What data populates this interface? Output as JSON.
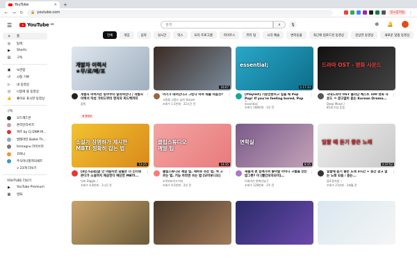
{
  "browser": {
    "tab_title": "YouTube",
    "url": "youtube.com",
    "profile_status": "일시중지됨"
  },
  "masthead": {
    "logo_text": "YouTube",
    "logo_region": "KR",
    "search_placeholder": "검색"
  },
  "sidebar": {
    "main": [
      {
        "icon": "home-icon",
        "glyph": "⌂",
        "label": "홈",
        "active": true
      },
      {
        "icon": "explore-icon",
        "glyph": "◎",
        "label": "탐색"
      },
      {
        "icon": "shorts-icon",
        "glyph": "▶",
        "label": "Shorts"
      },
      {
        "icon": "subscriptions-icon",
        "glyph": "▤",
        "label": "구독"
      }
    ],
    "library": [
      {
        "icon": "library-icon",
        "glyph": "▣",
        "label": "보관함"
      },
      {
        "icon": "history-icon",
        "glyph": "↺",
        "label": "시청 기록"
      },
      {
        "icon": "my-videos-icon",
        "glyph": "▷",
        "label": "내 동영상"
      },
      {
        "icon": "watch-later-icon",
        "glyph": "◷",
        "label": "나중에 볼 동영상"
      },
      {
        "icon": "liked-icon",
        "glyph": "👍",
        "label": "좋아요 표시한 동영상"
      }
    ],
    "subs_heading": "구독",
    "subscriptions": [
      {
        "label": "모드헤드폰",
        "color": "#333"
      },
      {
        "label": "온라인리서치",
        "color": "#c9a"
      },
      {
        "label": "퀴즈 by CJ ENM M...",
        "color": "#d33"
      },
      {
        "label": "발레마티 Ballet Th...",
        "color": "#8ab"
      },
      {
        "label": "Ilcmagnu 라이브러",
        "color": "#777"
      },
      {
        "label": "코파니",
        "color": "#e93"
      },
      {
        "label": "주식이나할까의세트",
        "color": "#39c"
      },
      {
        "label": "∨ 23개 더보기",
        "color": ""
      }
    ],
    "more_heading": "YOUTUBE 더보기",
    "more": [
      {
        "icon": "premium-icon",
        "glyph": "▶",
        "label": "YouTube Premium"
      },
      {
        "icon": "movies-icon",
        "glyph": "▦",
        "label": "영화"
      }
    ]
  },
  "chips": [
    "전체",
    "게임",
    "음악",
    "실시간",
    "믹스",
    "요리 프로그램",
    "라이트스",
    "뷰티 팁",
    "시각 예술",
    "변리동물",
    "최근에 업로드된 동영상",
    "감상한 동영상",
    "새로운 맞춤 동영상"
  ],
  "videos": [
    {
      "title": "개발자 이력서는 링쿠부터 달라야한다 | 개발자 이력서 작성 가이드부터 현직자 피드백까지",
      "channel": "잡톡",
      "stats": "",
      "badge": "새 동영상",
      "duration": "",
      "thumb_bg": "linear-gradient(135deg,#dfe6ee,#9fb0c0)",
      "thumb_text": "개발자 이력서\n★무/료/배/포",
      "text_color": "#111",
      "avatar": "#222"
    },
    {
      "title": "아기가 태어난다고 그린나 이여 뭐를 마음것?",
      "channel": "고원용 고종드 남자 Yonam",
      "stats": "조회수 1.5만회 · 22시간 전",
      "badge": "",
      "duration": "16:07",
      "thumb_bg": "linear-gradient(135deg,#3b2b24,#7a8b9b)",
      "thumb_text": "",
      "text_color": "#fff",
      "avatar": "#964"
    },
    {
      "title": "[Playlist] 기분전환하고 싶을 때 Pop Pop! If you're feeling bored, Pop Pop!",
      "channel": "essential;",
      "stats": "조회수 188만회 · 1년 전",
      "badge": "",
      "duration": "1:17:33",
      "thumb_bg": "linear-gradient(135deg,#2aa7c9,#0c6e8a)",
      "thumb_text": "essential;",
      "text_color": "#fff",
      "avatar": "#1a9"
    },
    {
      "title": "국내드라마 OST 플리단 베스트 100 명화 사운드 ㅋ 광고없이 듣는 Korean Drama...",
      "channel": "Deep Mood ♪",
      "stats": "85세 이상 듣음",
      "badge": "",
      "duration": "",
      "thumb_bg": "linear-gradient(135deg,#111,#444)",
      "thumb_text": "드라마 OST - 명화 사운드",
      "text_color": "#e44",
      "avatar": "#555"
    },
    {
      "title": "[4인가공원]글 안 마음이면 남들은 더 인터넷 본다가 소설까지 제공한다 예단한 MBTI...",
      "channel": "다표 Diggle ✓",
      "stats": "조회수 4.8만회 · 1시간 전",
      "badge": "",
      "duration": "13:25",
      "thumb_bg": "linear-gradient(135deg,#f2c230,#d98a1a)",
      "thumb_text": "소설가 장명하가 제시한\nMBTI 정확히 잡는 법",
      "text_color": "#fff",
      "avatar": "#e33"
    },
    {
      "title": "클립스튜디오 깨알 팁, 세브로 쓰는 법, 색 고르는 법, 기능 아라면 쓰는 법 [모아보니오]",
      "channel": "오락되보이드이리",
      "stats": "조회수 9.5만회 · 2년 전",
      "badge": "",
      "duration": "14:35",
      "thumb_bg": "linear-gradient(135deg,#f4a3a3,#e87b7b)",
      "thumb_text": "클립스튜디오\n깨알 팁",
      "text_color": "#fff",
      "avatar": "#f77"
    },
    {
      "title": "새롭게 편 함께가여 좋아할 아이디 구름을 만든 밥그릇? 이 [빨간모자오미]…",
      "channel": "다회이기 한화선뷰구",
      "stats": "조회수 128만회 · 2주 전",
      "badge": "",
      "duration": "8:35",
      "thumb_bg": "linear-gradient(135deg,#7a5a8a,#c3a3b8)",
      "thumb_text": "면학실",
      "text_color": "#fff",
      "avatar": "#a7c"
    },
    {
      "title": "일할때 듣기 좋은 노래 3시간 + 중간 광고 없는 노래 모음 / 듣는...",
      "channel": "음토뮤지엄 ✓",
      "stats": "조회수 21만회 · 3개월 전",
      "badge": "",
      "duration": "2:37:52",
      "thumb_bg": "linear-gradient(135deg,#eee,#c9c9c9)",
      "thumb_text": "일할 때 듣기 좋은 노래",
      "text_color": "#c22",
      "avatar": "#333"
    },
    {
      "title": "",
      "channel": "",
      "stats": "",
      "badge": "",
      "duration": "",
      "thumb_bg": "linear-gradient(135deg,#c8a36a,#6b5a3a)",
      "thumb_text": "",
      "text_color": "#fff",
      "avatar": ""
    },
    {
      "title": "",
      "channel": "",
      "stats": "",
      "badge": "",
      "duration": "",
      "thumb_bg": "linear-gradient(135deg,#4a3a2a,#a07a5a)",
      "thumb_text": "",
      "text_color": "#fff",
      "avatar": ""
    },
    {
      "title": "",
      "channel": "",
      "stats": "",
      "badge": "",
      "duration": "",
      "thumb_bg": "linear-gradient(135deg,#2a2a6a,#6a4aaa)",
      "thumb_text": "",
      "text_color": "#fff",
      "avatar": ""
    },
    {
      "title": "",
      "channel": "",
      "stats": "",
      "badge": "",
      "duration": "",
      "thumb_bg": "linear-gradient(135deg,#d9e8f0,#f5f5f5)",
      "thumb_text": "",
      "text_color": "#fff",
      "avatar": ""
    }
  ]
}
